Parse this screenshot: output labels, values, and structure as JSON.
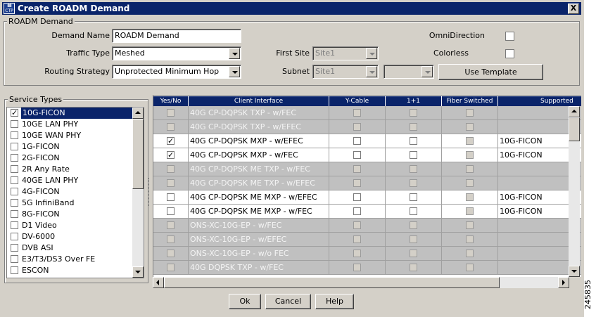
{
  "window": {
    "title": "Create ROADM Demand",
    "close_glyph": "X"
  },
  "demand_group": {
    "legend": "ROADM Demand",
    "demand_name_label": "Demand Name",
    "demand_name_value": "ROADM Demand",
    "traffic_type_label": "Traffic Type",
    "traffic_type_value": "Meshed",
    "routing_strategy_label": "Routing Strategy",
    "routing_strategy_value": "Unprotected Minimum Hop",
    "first_site_label": "First Site",
    "first_site_value": "Site1",
    "subnet_label": "Subnet",
    "subnet_value": "Site1",
    "subnet_extra_value": "",
    "omnidirection_label": "OmniDirection",
    "omnidirection_checked": false,
    "colorless_label": "Colorless",
    "colorless_checked": false,
    "use_template_label": "Use Template"
  },
  "service_types": {
    "legend": "Service Types",
    "items": [
      {
        "label": "10G-FICON",
        "checked": true,
        "selected": true
      },
      {
        "label": "10GE LAN PHY",
        "checked": false
      },
      {
        "label": "10GE WAN PHY",
        "checked": false
      },
      {
        "label": "1G-FICON",
        "checked": false
      },
      {
        "label": "2G-FICON",
        "checked": false
      },
      {
        "label": "2R Any Rate",
        "checked": false
      },
      {
        "label": "40GE LAN PHY",
        "checked": false
      },
      {
        "label": "4G-FICON",
        "checked": false
      },
      {
        "label": "5G InfiniBand",
        "checked": false
      },
      {
        "label": "8G-FICON",
        "checked": false
      },
      {
        "label": "D1 Video",
        "checked": false
      },
      {
        "label": "DV-6000",
        "checked": false
      },
      {
        "label": "DVB ASI",
        "checked": false
      },
      {
        "label": "E3/T3/DS3 Over FE",
        "checked": false
      },
      {
        "label": "ESCON",
        "checked": false
      }
    ]
  },
  "table": {
    "headers": [
      "Yes/No",
      "Client Interface",
      "Y-Cable",
      "1+1",
      "Fiber Switched",
      "Supported"
    ],
    "rows": [
      {
        "enabled": false,
        "yes": false,
        "interface": "40G CP-DQPSK TXP - w/FEC",
        "supported": ""
      },
      {
        "enabled": false,
        "yes": false,
        "interface": "40G CP-DQPSK TXP - w/EFEC",
        "supported": ""
      },
      {
        "enabled": true,
        "yes": true,
        "interface": "40G CP-DQPSK MXP - w/EFEC",
        "supported": "10G-FICON"
      },
      {
        "enabled": true,
        "yes": true,
        "interface": "40G CP-DQPSK MXP - w/FEC",
        "supported": "10G-FICON"
      },
      {
        "enabled": false,
        "yes": false,
        "interface": "40G CP-DQPSK ME TXP - w/FEC",
        "supported": ""
      },
      {
        "enabled": false,
        "yes": false,
        "interface": "40G CP-DQPSK ME TXP - w/EFEC",
        "supported": ""
      },
      {
        "enabled": true,
        "yes": false,
        "interface": "40G CP-DQPSK ME MXP - w/EFEC",
        "supported": "10G-FICON"
      },
      {
        "enabled": true,
        "yes": false,
        "interface": "40G CP-DQPSK ME MXP - w/FEC",
        "supported": "10G-FICON"
      },
      {
        "enabled": false,
        "yes": false,
        "interface": "ONS-XC-10G-EP - w/FEC",
        "supported": ""
      },
      {
        "enabled": false,
        "yes": false,
        "interface": "ONS-XC-10G-EP - w/EFEC",
        "supported": ""
      },
      {
        "enabled": false,
        "yes": false,
        "interface": "ONS-XC-10G-EP - w/o FEC",
        "supported": ""
      },
      {
        "enabled": false,
        "yes": false,
        "interface": "40G DQPSK TXP - w/FEC",
        "supported": ""
      }
    ]
  },
  "buttons": {
    "ok": "Ok",
    "cancel": "Cancel",
    "help": "Help"
  },
  "figure_id": "245835"
}
